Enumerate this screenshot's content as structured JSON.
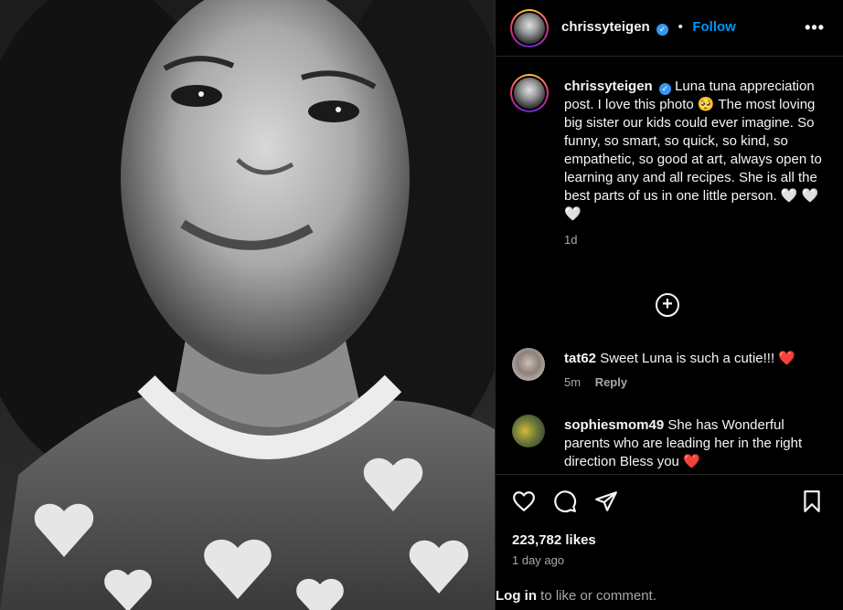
{
  "post": {
    "username": "chrissyteigen",
    "follow_label": "Follow",
    "more_label": "•••",
    "caption_text": "Luna tuna appreciation post. I love this photo 🥺 The most loving big sister our kids could ever imagine. So funny, so smart, so quick, so kind, so empathetic, so good at art, always open to learning any and all recipes. She is all the best parts of us in one little person. 🤍 🤍 🤍",
    "caption_age": "1d",
    "likes": "223,782 likes",
    "posted_ago": "1 day ago"
  },
  "comments": [
    {
      "username": "tat62",
      "text": "Sweet Luna is such a cutie!!! ❤️",
      "age": "5m",
      "reply_label": "Reply"
    },
    {
      "username": "sophiesmom49",
      "text": "She has Wonderful parents who are leading her in the right direction Bless you ❤️"
    }
  ],
  "footer": {
    "login_label": "Log in",
    "rest": " to like or comment."
  },
  "icons": {
    "heart": "heart-icon",
    "comment": "comment-icon",
    "share": "share-icon",
    "save": "bookmark-icon",
    "add": "add-circle-icon",
    "verified": "verified-badge-icon"
  },
  "colors": {
    "accent": "#0095f6",
    "verified": "#3897f0",
    "heart_red": "#ed4956"
  }
}
